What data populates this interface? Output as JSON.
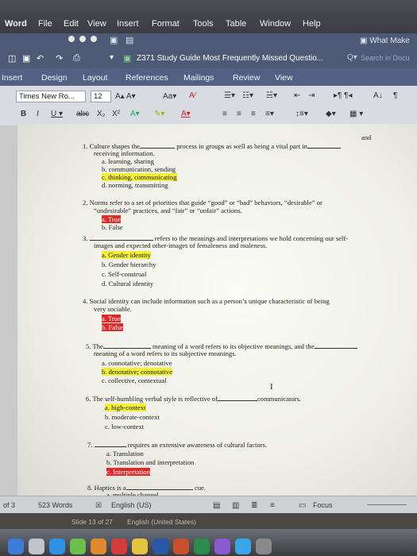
{
  "menubar": {
    "app": "Word",
    "items": [
      "File",
      "Edit",
      "View",
      "Insert",
      "Format",
      "Tools",
      "Table",
      "Window",
      "Help"
    ]
  },
  "window": {
    "search_hint": "What Make",
    "doc_title": "Z371 Study Guide Most Frequently Missed Questio...",
    "search_placeholder": "Search in Docu"
  },
  "ribbon": {
    "tabs": [
      "Insert",
      "Design",
      "Layout",
      "References",
      "Mailings",
      "Review",
      "View"
    ],
    "font_name": "Times New Ro...",
    "font_size": "12"
  },
  "document": {
    "top_fragment": "and",
    "questions": [
      {
        "num": "1.",
        "lines": [
          "Culture shapes the",
          "process in groups as well as being a vital part in",
          "receiving information."
        ],
        "options": [
          {
            "l": "a.",
            "t": "learning, sharing",
            "hl": ""
          },
          {
            "l": "b.",
            "t": "communication, sending",
            "hl": ""
          },
          {
            "l": "c.",
            "t": "thinking, communicating",
            "hl": "yellow"
          },
          {
            "l": "d.",
            "t": "norming, transmitting",
            "hl": ""
          }
        ]
      },
      {
        "num": "2.",
        "lines": [
          "Norms refer to a set of priorities that guide “good” or “bad” behaviors, “desirable” or",
          "“undesirable” practices, and “fair” or “unfair” actions."
        ],
        "options": [
          {
            "l": "a.",
            "t": "True",
            "hl": "red"
          },
          {
            "l": "b.",
            "t": "False",
            "hl": ""
          }
        ]
      },
      {
        "num": "3.",
        "lines": [
          "refers to the meanings and interpretations we hold concerning our self-",
          "images and expected other-images of femaleness and maleness."
        ],
        "options": [
          {
            "l": "a.",
            "t": "Gender identity",
            "hl": "yellow"
          },
          {
            "l": "b.",
            "t": "Gender hierarchy",
            "hl": ""
          },
          {
            "l": "c.",
            "t": "Self-construal",
            "hl": ""
          },
          {
            "l": "d.",
            "t": "Cultural identity",
            "hl": ""
          }
        ]
      },
      {
        "num": "4.",
        "lines": [
          "Social identity can include information such as a person’s unique characteristic of being",
          "very sociable."
        ],
        "options": [
          {
            "l": "a.",
            "t": "True",
            "hl": "red"
          },
          {
            "l": "b.",
            "t": "False",
            "hl": "red"
          }
        ]
      },
      {
        "num": "5.",
        "lines": [
          "The",
          "meaning of a word refers to its objective meanings, and the",
          "meaning of a word refers to its subjective meanings."
        ],
        "options": [
          {
            "l": "a.",
            "t": "connotative; denotative",
            "hl": ""
          },
          {
            "l": "b.",
            "t": "denotative; connotative",
            "hl": "yellow"
          },
          {
            "l": "c.",
            "t": "collective, contextual",
            "hl": ""
          }
        ]
      },
      {
        "num": "6.",
        "lines": [
          "The self-humbling verbal style is reflective of",
          "communicators."
        ],
        "options": [
          {
            "l": "a.",
            "t": "high-context",
            "hl": "yellow"
          },
          {
            "l": "b.",
            "t": "moderate-context",
            "hl": ""
          },
          {
            "l": "c.",
            "t": "low-context",
            "hl": ""
          }
        ]
      },
      {
        "num": "7.",
        "lines": [
          "requires an extensive awareness of cultural factors."
        ],
        "options": [
          {
            "l": "a.",
            "t": "Translation",
            "hl": ""
          },
          {
            "l": "b.",
            "t": "Translation and interpretation",
            "hl": ""
          },
          {
            "l": "c.",
            "t": "Interpretation",
            "hl": "red"
          }
        ]
      },
      {
        "num": "8.",
        "lines": [
          "Haptics is a",
          "cue."
        ],
        "options": [
          {
            "l": "a.",
            "t": "multiple channel",
            "hl": ""
          }
        ]
      }
    ]
  },
  "statusbar": {
    "page": "of 3",
    "words": "523 Words",
    "language": "English (US)",
    "focus": "Focus"
  },
  "background_window": {
    "slide": "Slide 13 of 27",
    "language": "English (United States)"
  },
  "colors": {
    "highlight_yellow": "#f3ef3a",
    "highlight_red": "#dd2a2a",
    "titlebar": "#4d5a76"
  }
}
